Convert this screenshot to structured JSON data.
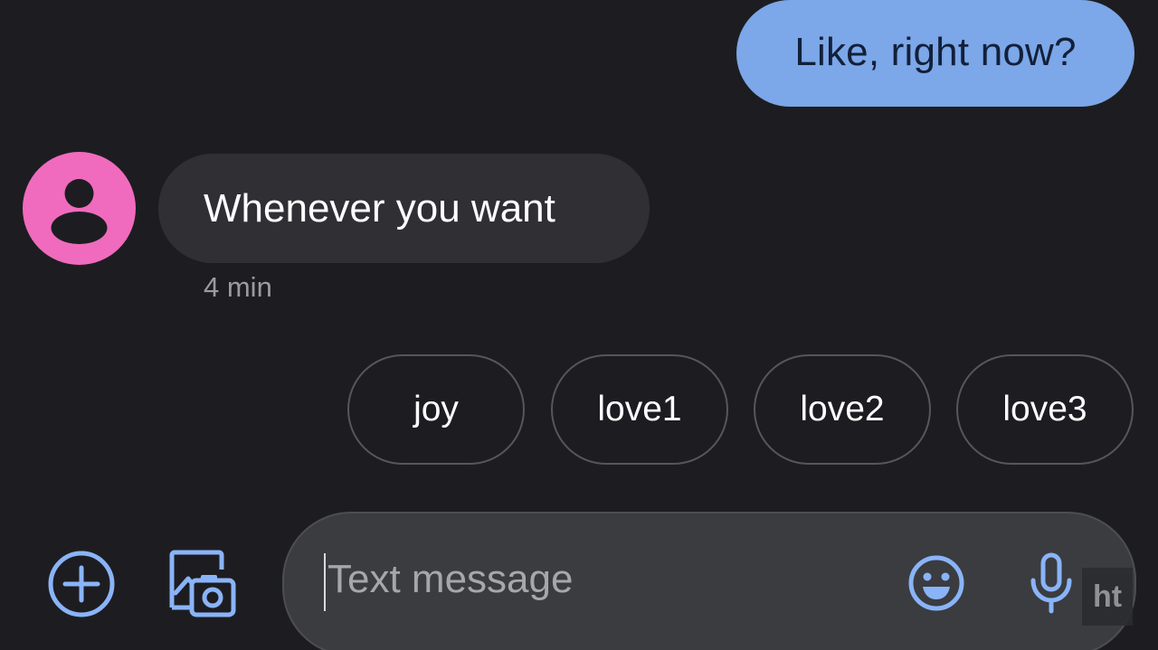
{
  "conversation": {
    "outgoing": [
      {
        "text": "Like, right now?"
      }
    ],
    "incoming": [
      {
        "text": "Whenever you want",
        "timestamp": "4 min"
      }
    ]
  },
  "suggestions": [
    "joy",
    "love1",
    "love2",
    "love3"
  ],
  "compose": {
    "placeholder": "Text message"
  },
  "watermark": "ht",
  "colors": {
    "background": "#1d1d21",
    "outgoing_bubble": "#7ca7e8",
    "incoming_bubble": "#2f2f34",
    "avatar": "#f06bbd",
    "accent_icons": "#8ab4f8",
    "compose_bar": "#3a3c40"
  },
  "icons": {
    "attach": "add-circle-icon",
    "gallery": "gallery-camera-icon",
    "emoji": "emoji-icon",
    "voice": "microphone-icon",
    "avatar": "person-icon"
  }
}
